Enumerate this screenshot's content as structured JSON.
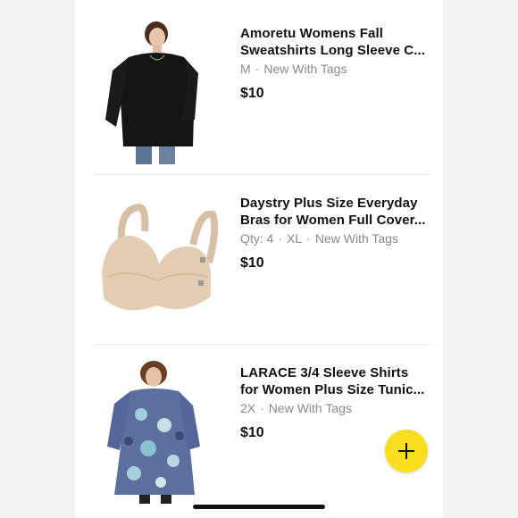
{
  "listings": [
    {
      "title_line1": "Amoretu Womens Fall",
      "title_line2": "Sweatshirts Long Sleeve C...",
      "meta": [
        "M",
        "New With Tags"
      ],
      "price": "$10",
      "image_icon": "black-sweatshirt-photo"
    },
    {
      "title_line1": "Daystry Plus Size Everyday",
      "title_line2": "Bras for Women Full Cover...",
      "meta": [
        "Qty: 4",
        "XL",
        "New With Tags"
      ],
      "price": "$10",
      "image_icon": "beige-bra-photo"
    },
    {
      "title_line1": "LARACE 3/4 Sleeve Shirts",
      "title_line2": "for Women Plus Size Tunic...",
      "meta": [
        "2X",
        "New With Tags"
      ],
      "price": "$10",
      "image_icon": "paisley-tunic-photo"
    }
  ],
  "separator": "·",
  "fab": {
    "icon": "plus-icon",
    "color": "#f8de1e"
  }
}
